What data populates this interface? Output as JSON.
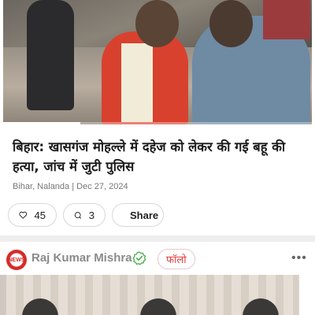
{
  "article": {
    "headline": "बिहार: खासगंज मोहल्ले में दहेज को लेकर की गई बहू की हत्या, जांच में जुटी पुलिस",
    "meta": "Bihar, Nalanda | Dec 27, 2024",
    "video_progress": 0.25
  },
  "actions": {
    "likes": "45",
    "comments": "3",
    "share_label": "Share"
  },
  "post": {
    "avatar_text": "NEWS",
    "author": "Raj Kumar Mishra",
    "follow_label": "फॉलो",
    "more_label": "•••"
  },
  "colors": {
    "accent_red": "#e23b3b",
    "whatsapp_green": "#25d366",
    "verified_green": "#4caf50"
  }
}
